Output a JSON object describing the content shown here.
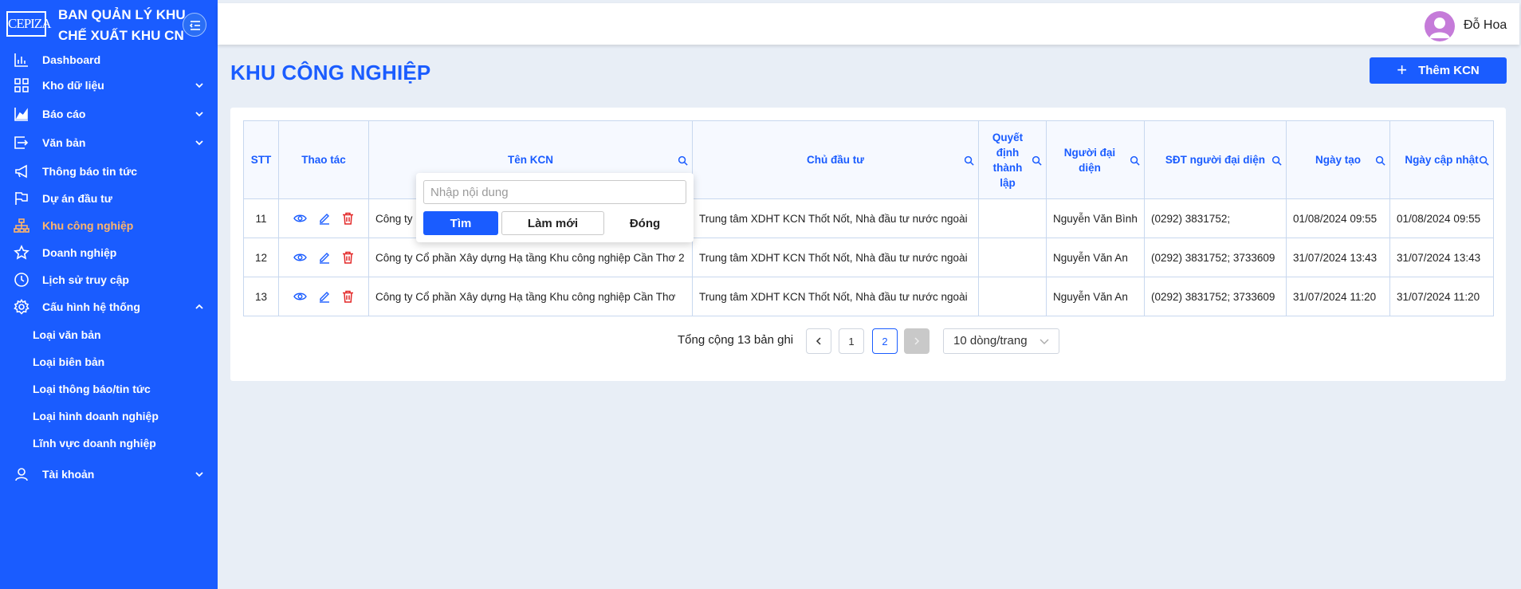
{
  "brand": {
    "logo_text": "CEPIZA",
    "title_line1": "BAN QUẢN LÝ KHU",
    "title_line2": "CHẾ XUẤT KHU CN"
  },
  "sidebar": {
    "items": [
      {
        "label": "Dashboard",
        "icon": "bar-chart-icon"
      },
      {
        "label": "Kho dữ liệu",
        "icon": "grid-icon"
      },
      {
        "label": "Báo cáo",
        "icon": "area-chart-icon"
      },
      {
        "label": "Văn bản",
        "icon": "document-export-icon"
      },
      {
        "label": "Thông báo tin tức",
        "icon": "megaphone-icon"
      },
      {
        "label": "Dự án đầu tư",
        "icon": "flag-icon"
      },
      {
        "label": "Khu công nghiệp",
        "icon": "cluster-icon"
      },
      {
        "label": "Doanh nghiệp",
        "icon": "star-icon"
      },
      {
        "label": "Lịch sử truy cập",
        "icon": "clock-icon"
      },
      {
        "label": "Cấu hình hệ thống",
        "icon": "gear-icon"
      },
      {
        "label": "Tài khoản",
        "icon": "user-icon"
      }
    ],
    "sub_items": [
      {
        "label": "Loại văn bản"
      },
      {
        "label": "Loại biên bản"
      },
      {
        "label": "Loại thông báo/tin tức"
      },
      {
        "label": "Loại hình doanh nghiệp"
      },
      {
        "label": "Lĩnh vực doanh nghiệp"
      }
    ],
    "active_item": "Khu công nghiệp",
    "colors": {
      "background": "#1a5cff",
      "active_text": "#ffb56b"
    }
  },
  "header": {
    "user_name": "Đỗ Hoa"
  },
  "page": {
    "title": "KHU CÔNG NGHIỆP",
    "add_button": "Thêm KCN"
  },
  "table": {
    "headers": {
      "stt": "STT",
      "actions": "Thao tác",
      "name": "Tên KCN",
      "investor": "Chủ đầu tư",
      "decision": "Quyết định thành lập",
      "representative": "Người đại diện",
      "phone": "SĐT người đại diện",
      "created": "Ngày tạo",
      "updated": "Ngày cập nhật"
    },
    "rows": [
      {
        "stt": "11",
        "name": "Công ty C",
        "investor": "Trung tâm XDHT KCN Thốt Nốt, Nhà đầu tư nước ngoài",
        "decision": "",
        "representative": "Nguyễn Văn Bình",
        "phone": "(0292) 3831752;",
        "created": "01/08/2024 09:55",
        "updated": "01/08/2024 09:55"
      },
      {
        "stt": "12",
        "name": "Công ty Cổ phần Xây dựng Hạ tầng Khu công nghiệp Cần Thơ 2",
        "investor": "Trung tâm XDHT KCN Thốt Nốt, Nhà đầu tư nước ngoài",
        "decision": "",
        "representative": "Nguyễn Văn An",
        "phone": "(0292) 3831752; 3733609",
        "created": "31/07/2024 13:43",
        "updated": "31/07/2024 13:43"
      },
      {
        "stt": "13",
        "name": "Công ty Cổ phần Xây dựng Hạ tầng Khu công nghiệp Cần Thơ",
        "investor": "Trung tâm XDHT KCN Thốt Nốt, Nhà đầu tư nước ngoài",
        "decision": "",
        "representative": "Nguyễn Văn An",
        "phone": "(0292) 3831752; 3733609",
        "created": "31/07/2024 11:20",
        "updated": "31/07/2024 11:20"
      }
    ]
  },
  "search_popup": {
    "placeholder": "Nhập nội dung",
    "find": "Tìm",
    "reset": "Làm mới",
    "close": "Đóng"
  },
  "pagination": {
    "total_text": "Tổng cộng 13 bản ghi",
    "pages": [
      "1",
      "2"
    ],
    "current": "2",
    "page_size": "10 dòng/trang"
  }
}
